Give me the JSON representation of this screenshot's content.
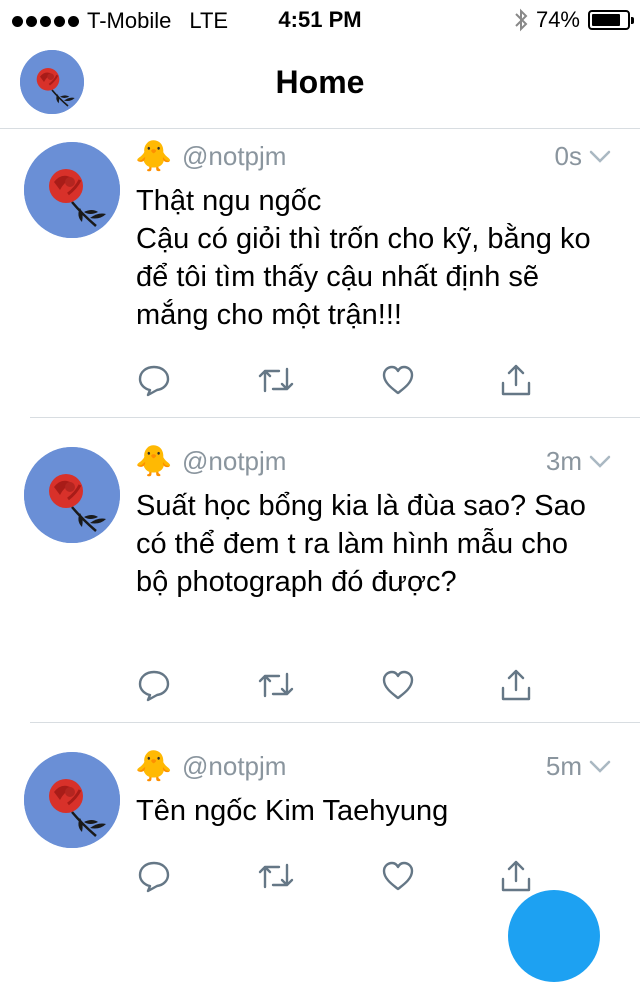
{
  "status_bar": {
    "carrier": "T-Mobile",
    "network": "LTE",
    "time": "4:51 PM",
    "battery_percent": "74%",
    "signal_bars": 5,
    "icons": [
      "signal-dots-icon",
      "bluetooth-icon",
      "battery-icon"
    ]
  },
  "nav": {
    "title": "Home",
    "avatar_icon": "rose-avatar"
  },
  "tweets": [
    {
      "handle": "@notpjm",
      "time": "0s",
      "emoji": "🐥",
      "text": "Thật ngu ngốc\nCậu có giỏi thì trốn cho kỹ, bằng ko để tôi tìm thấy cậu nhất định sẽ mắng cho một trận!!!"
    },
    {
      "handle": "@notpjm",
      "time": "3m",
      "emoji": "🐥",
      "text": "Suất học bổng kia là đùa sao? Sao có thể đem t ra làm hình mẫu cho bộ photograph đó được?"
    },
    {
      "handle": "@notpjm",
      "time": "5m",
      "emoji": "🐥",
      "text": "Tên ngốc Kim Taehyung"
    }
  ],
  "action_icons": [
    "reply-icon",
    "retweet-icon",
    "like-icon",
    "share-icon"
  ],
  "colors": {
    "accent": "#1da1f2",
    "secondary_text": "#8a959e",
    "divider": "#d8dde1",
    "icon": "#657786"
  }
}
